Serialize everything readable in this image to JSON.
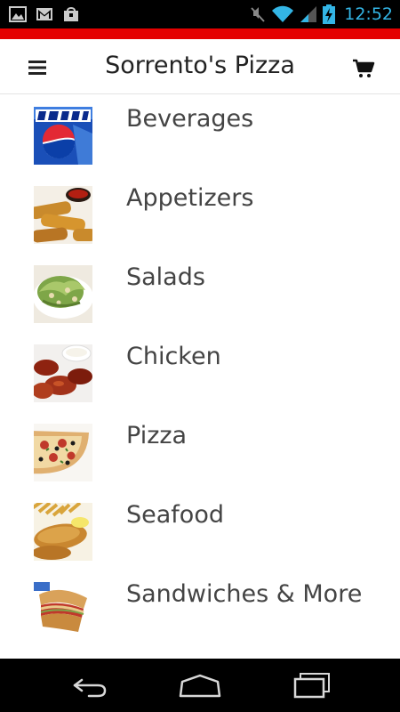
{
  "status_bar": {
    "time": "12:52",
    "time_color": "#33b5e5",
    "icons": [
      "gallery-icon",
      "gmail-icon",
      "shopping-bag-icon",
      "mute-icon",
      "wifi-icon",
      "signal-icon",
      "battery-charging-icon"
    ]
  },
  "accent_color": "#e40000",
  "app_bar": {
    "title": "Sorrento's Pizza",
    "left_icon": "menu-icon",
    "right_icon": "cart-icon"
  },
  "categories": [
    {
      "label": "Beverages",
      "image": "pepsi-image"
    },
    {
      "label": "Appetizers",
      "image": "mozzarella-sticks-image"
    },
    {
      "label": "Salads",
      "image": "caesar-salad-image"
    },
    {
      "label": "Chicken",
      "image": "chicken-wings-image"
    },
    {
      "label": "Pizza",
      "image": "pizza-image"
    },
    {
      "label": "Seafood",
      "image": "fried-fish-image"
    },
    {
      "label": "Sandwiches & More",
      "image": "sub-sandwich-image"
    }
  ],
  "nav_bar": {
    "icons": [
      "back-icon",
      "home-icon",
      "recent-apps-icon"
    ]
  }
}
